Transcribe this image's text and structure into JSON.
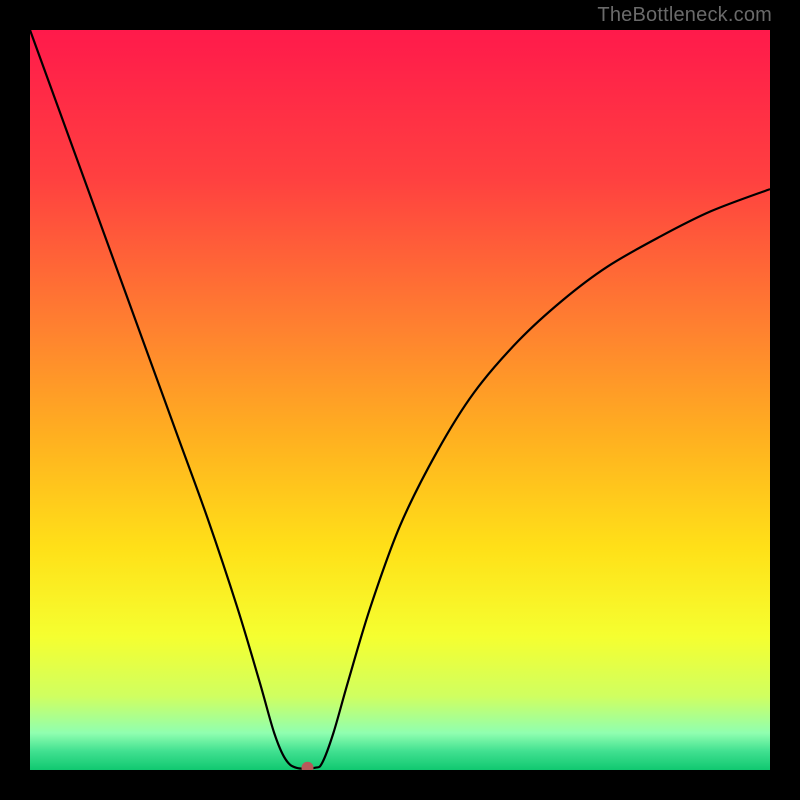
{
  "watermark": "TheBottleneck.com",
  "chart_data": {
    "type": "line",
    "title": "",
    "xlabel": "",
    "ylabel": "",
    "xlim": [
      0,
      100
    ],
    "ylim": [
      0,
      100
    ],
    "grid": false,
    "legend": false,
    "background_gradient": {
      "type": "vertical",
      "stops": [
        {
          "offset": 0.0,
          "color": "#ff1a4b"
        },
        {
          "offset": 0.2,
          "color": "#ff4040"
        },
        {
          "offset": 0.4,
          "color": "#ff8030"
        },
        {
          "offset": 0.55,
          "color": "#ffb020"
        },
        {
          "offset": 0.7,
          "color": "#ffe018"
        },
        {
          "offset": 0.82,
          "color": "#f5ff30"
        },
        {
          "offset": 0.9,
          "color": "#d0ff60"
        },
        {
          "offset": 0.95,
          "color": "#90ffb0"
        },
        {
          "offset": 0.975,
          "color": "#40e090"
        },
        {
          "offset": 1.0,
          "color": "#10c870"
        }
      ]
    },
    "series": [
      {
        "name": "bottleneck-curve",
        "color": "#000000",
        "width": 2.2,
        "x": [
          0,
          4,
          8,
          12,
          16,
          20,
          24,
          28,
          31,
          33,
          34.5,
          36,
          38.5,
          39.5,
          41,
          43,
          46,
          50,
          55,
          60,
          66,
          72,
          78,
          85,
          92,
          100
        ],
        "y": [
          100,
          89,
          78,
          67,
          56,
          45,
          34,
          22,
          12,
          5,
          1.5,
          0.3,
          0.3,
          1,
          5,
          12,
          22,
          33,
          43,
          51,
          58,
          63.5,
          68,
          72,
          75.5,
          78.5
        ]
      }
    ],
    "markers": [
      {
        "name": "optimum-point",
        "x": 37.5,
        "y": 0.3,
        "r": 6,
        "color": "#b75a5a"
      }
    ]
  }
}
